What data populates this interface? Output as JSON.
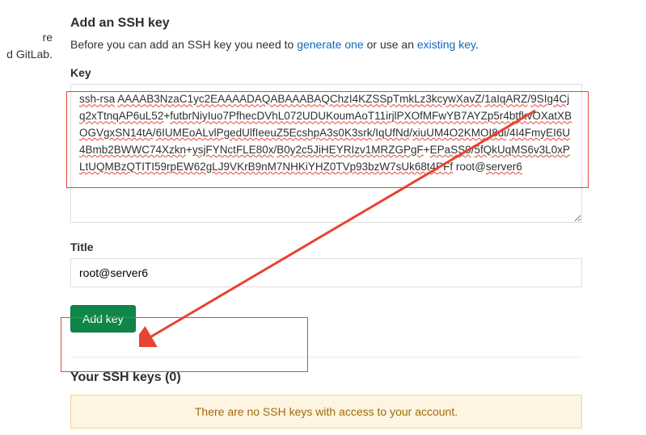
{
  "left_fragment_line1": "re",
  "left_fragment_line2": "d GitLab.",
  "heading": "Add an SSH key",
  "intro_pre": "Before you can add an SSH key you need to ",
  "intro_link1": "generate one",
  "intro_mid": " or use an ",
  "intro_link2": "existing key",
  "intro_post": ".",
  "key_label": "Key",
  "key_value": "ssh-rsa AAAAB3NzaC1yc2EAAAADAQABAAABAQChzI4KZSSpTmkLz3kcywXavZ/1aIqARZ/9SIg4Cjq2xTtnqAP6uL52+futbrNiyIuo7PfhecDVhL072UDUKoumAoT11irjlPXOfMFwYB7AYZp5r4btfkvOXatXBOGVgxSN14tA/6IUMEoALvlPgedUlfIeeuZ5EcshpA3s0K3srk/IqUfNd/xiuUM4O2KMOI8di/4I4FmyEI6U4Bmb2BWWC74Xzkn+ysjFYNctFLE80x/B0y2c5JiHEYRIzv1MRZGPgF+EPaSS9/5fQkUqMS6v3L0xPLtUQMBzQTITI59rpEW62gLJ9VKrB9nM7NHKiYHZ0TVp93bzW7sUk68t4PFf root@server6",
  "title_label": "Title",
  "title_value": "root@server6",
  "add_key_label": "Add key",
  "your_keys_heading": "Your SSH keys (0)",
  "no_keys_msg": "There are no SSH keys with access to your account."
}
